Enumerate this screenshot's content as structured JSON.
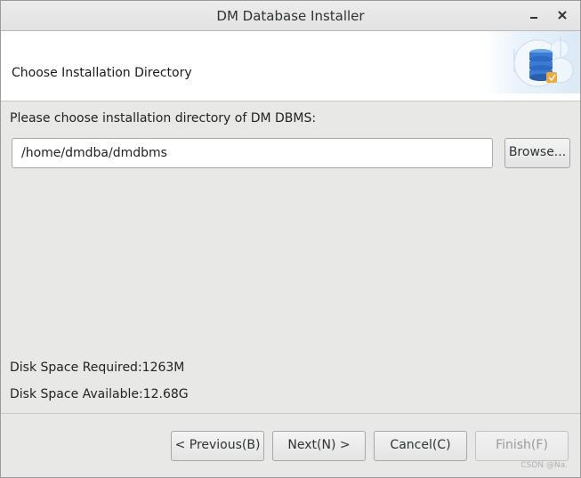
{
  "window": {
    "title": "DM Database Installer",
    "minimize_icon": "minimize-icon",
    "close_icon": "close-icon"
  },
  "header": {
    "title": "Choose Installation Directory",
    "banner_icon": "database-server-icon",
    "colors": {
      "accent": "#3a7bd5",
      "light": "#d7e8f7"
    }
  },
  "form": {
    "prompt": "Please choose installation directory of DM DBMS:",
    "path_value": "/home/dmdba/dmdbms",
    "browse_label": "Browse..."
  },
  "disk": {
    "required": "Disk Space Required:1263M",
    "available": "Disk Space Available:12.68G"
  },
  "footer": {
    "previous_label": "< Previous(B)",
    "next_label": "Next(N) >",
    "cancel_label": "Cancel(C)",
    "finish_label": "Finish(F)"
  },
  "watermark": "CSDN @Na."
}
